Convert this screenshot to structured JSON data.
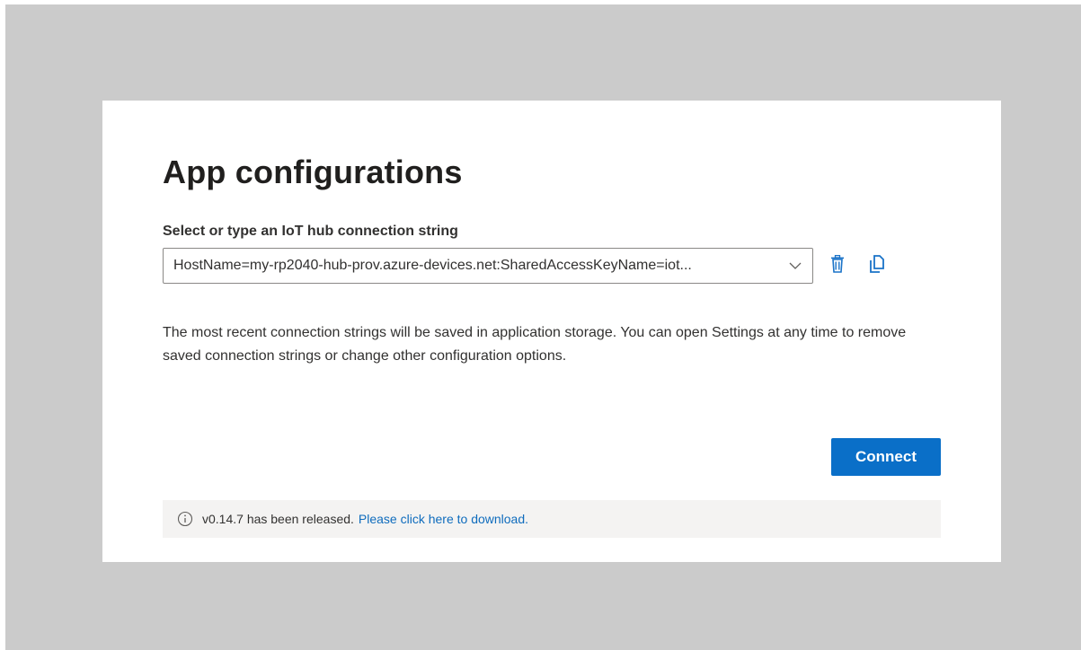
{
  "dialog": {
    "title": "App configurations",
    "connection_label": "Select or type an IoT hub connection string",
    "connection_value": "HostName=my-rp2040-hub-prov.azure-devices.net:SharedAccessKeyName=iot...",
    "help_text": "The most recent connection strings will be saved in application storage. You can open Settings at any time to remove saved connection strings or change other configuration options.",
    "connect_label": "Connect"
  },
  "notice": {
    "text": "v0.14.7 has been released.",
    "link_text": "Please click here to download."
  },
  "icons": {
    "dropdown": "chevron-down-icon",
    "delete": "delete-icon",
    "copy": "copy-icon",
    "info": "info-icon"
  },
  "colors": {
    "backdrop": "#cbcbcb",
    "primary_button": "#0a6fc8",
    "link": "#0f6cbd",
    "icon_accent": "#1a73c8",
    "notice_background": "#f4f3f2"
  }
}
